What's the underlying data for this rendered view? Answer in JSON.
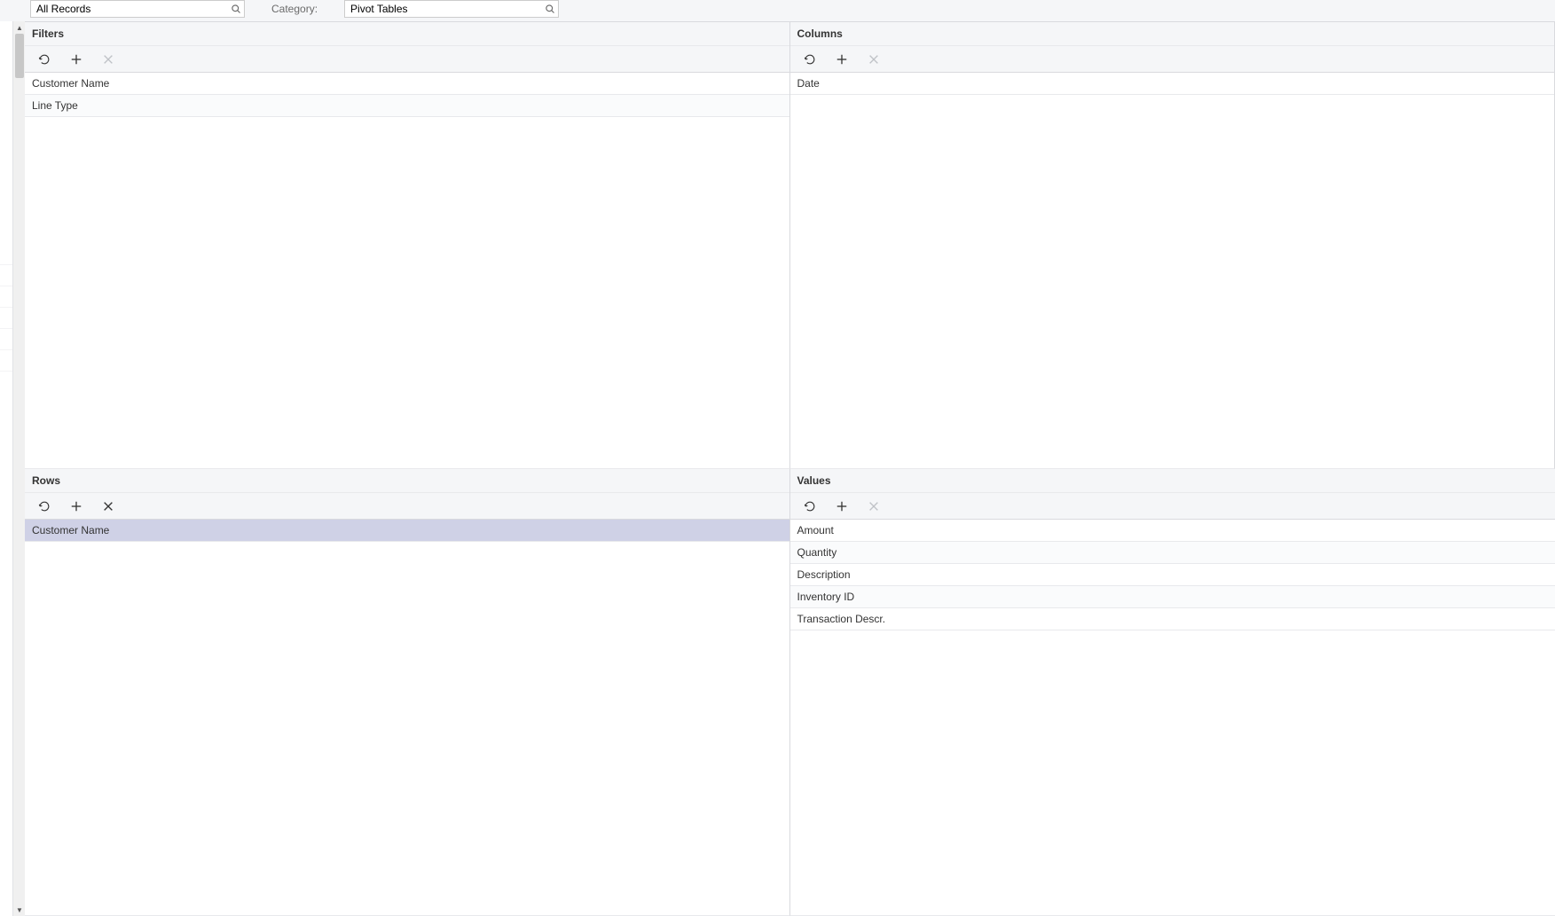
{
  "top": {
    "records_value": "All Records",
    "category_label": "Category:",
    "category_value": "Pivot Tables"
  },
  "panels": {
    "filters": {
      "title": "Filters",
      "items": [
        "Customer Name",
        "Line Type"
      ]
    },
    "columns": {
      "title": "Columns",
      "items": [
        "Date"
      ]
    },
    "rows": {
      "title": "Rows",
      "items": [
        "Customer Name"
      ],
      "selected_index": 0
    },
    "values": {
      "title": "Values",
      "items": [
        "Amount",
        "Quantity",
        "Description",
        "Inventory ID",
        "Transaction Descr."
      ]
    }
  }
}
